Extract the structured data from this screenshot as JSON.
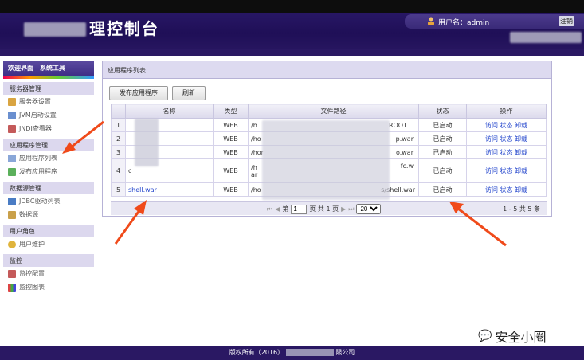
{
  "header": {
    "title": "理控制台",
    "user_label": "用户名：admin",
    "logout_label": "注销"
  },
  "sidebar": {
    "tabs": [
      "欢迎界面",
      "系统工具"
    ],
    "sections": [
      {
        "title": "服务器管理",
        "items": [
          "服务器设置",
          "JVM启动设置",
          "JNDI查看器"
        ]
      },
      {
        "title": "应用程序管理",
        "items": [
          "应用程序列表",
          "发布应用程序"
        ]
      },
      {
        "title": "数据源管理",
        "items": [
          "JDBC驱动列表",
          "数据源"
        ]
      },
      {
        "title": "用户角色",
        "items": [
          "用户维护"
        ]
      },
      {
        "title": "监控",
        "items": [
          "监控配置",
          "监控图表"
        ]
      }
    ]
  },
  "main": {
    "title": "应用程序列表",
    "buttons": {
      "publish": "发布应用程序",
      "refresh": "刷新"
    },
    "columns": [
      "名称",
      "类型",
      "文件路径",
      "状态",
      "操作"
    ],
    "rows": [
      {
        "num": "1",
        "name": "",
        "type": "WEB",
        "path_start": "/h",
        "path_end": "ROOT",
        "status": "已启动"
      },
      {
        "num": "2",
        "name": "",
        "type": "WEB",
        "path_start": "/ho",
        "path_end": "p.war",
        "status": "已启动"
      },
      {
        "num": "3",
        "name": "",
        "type": "WEB",
        "path_start": "/hor",
        "path_end": "o.war",
        "status": "已启动"
      },
      {
        "num": "4",
        "name": "c",
        "type": "WEB",
        "path_start": "/h",
        "path_end": "fc.w",
        "path_line2": "ar",
        "status": "已启动"
      },
      {
        "num": "5",
        "name": "shell.war",
        "type": "WEB",
        "path_start": "/ho",
        "path_end": "s/shell.war",
        "status": "已启动"
      }
    ],
    "actions": [
      "访问",
      "状态",
      "卸载"
    ],
    "pager": {
      "page_prefix": "第",
      "page_value": "1",
      "page_suffix": "页 共 1 页",
      "page_size": "20",
      "info": "1 - 5   共 5 条"
    }
  },
  "footer": {
    "text_start": "版权所有（2016）",
    "text_end": "限公司"
  },
  "watermark": "安全小圈",
  "colors": {
    "header": "#1f0f57",
    "accent": "#2a1863",
    "arrow": "#f04a1a",
    "link": "#2244cc"
  }
}
